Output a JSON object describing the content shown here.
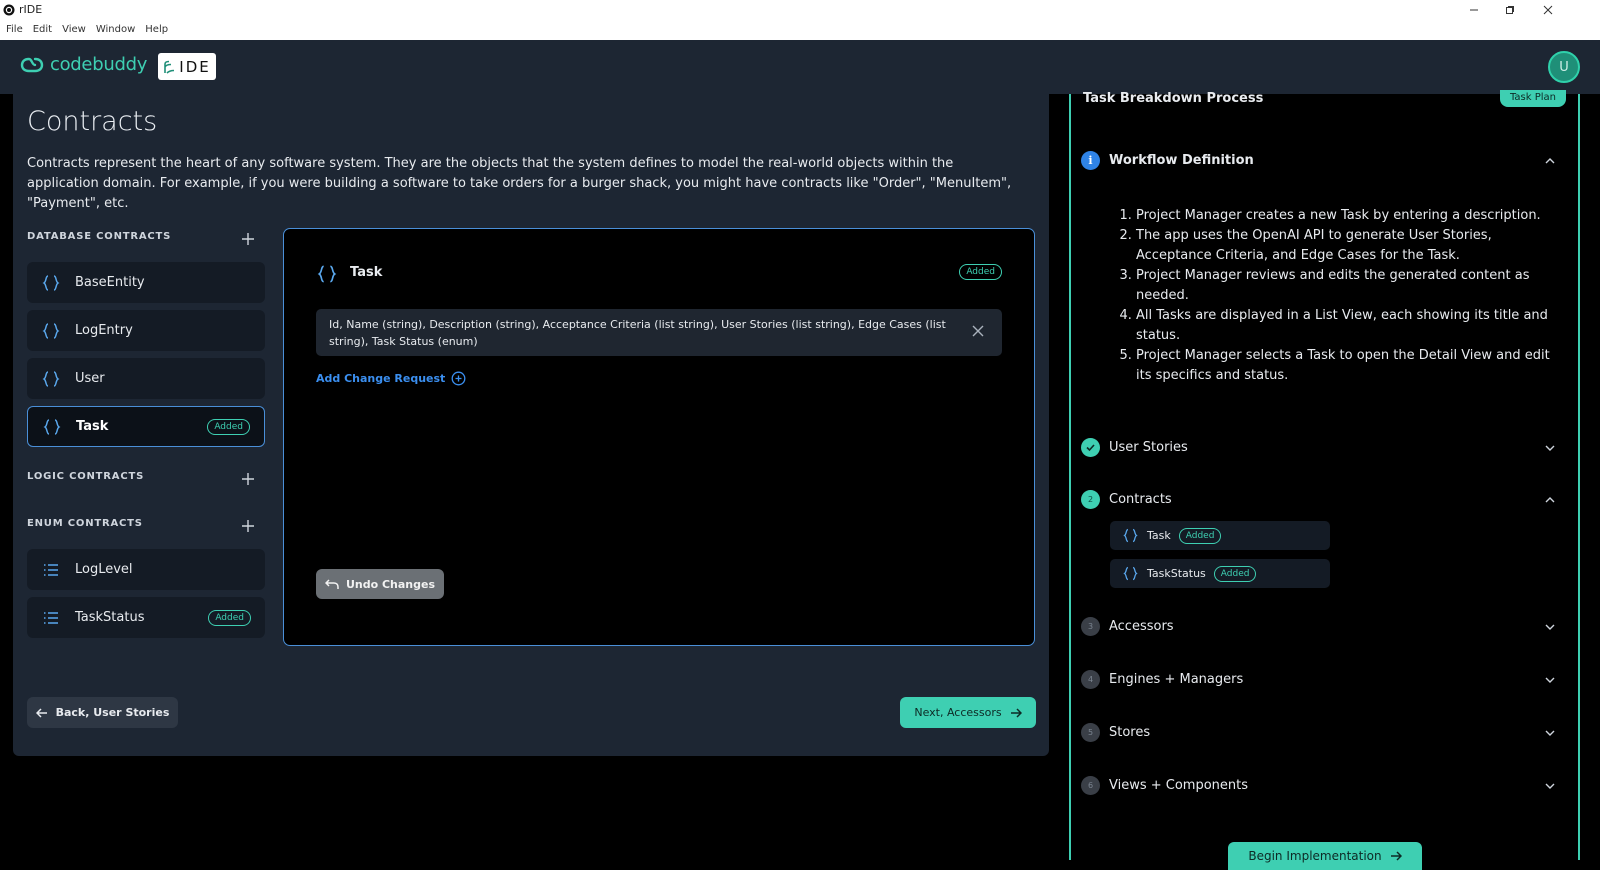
{
  "window": {
    "title": "rIDE"
  },
  "menu": [
    "File",
    "Edit",
    "View",
    "Window",
    "Help"
  ],
  "header": {
    "brand": "codebuddy",
    "product": "IDE",
    "avatar_initial": "U"
  },
  "main": {
    "title": "Contracts",
    "intro": "Contracts represent the heart of any software system. They are the objects that the system defines to model the real-world objects within the application domain. For example, if you were building a software to take orders for a burger shack, you might have contracts like \"Order\", \"MenuItem\", \"Payment\", etc.",
    "database_label": "DATABASE CONTRACTS",
    "logic_label": "LOGIC CONTRACTS",
    "enum_label": "ENUM CONTRACTS",
    "database_contracts": [
      {
        "name": "BaseEntity",
        "badge": ""
      },
      {
        "name": "LogEntry",
        "badge": ""
      },
      {
        "name": "User",
        "badge": ""
      },
      {
        "name": "Task",
        "badge": "Added"
      }
    ],
    "enum_contracts": [
      {
        "name": "LogLevel",
        "badge": ""
      },
      {
        "name": "TaskStatus",
        "badge": "Added"
      }
    ],
    "editor": {
      "title": "Task",
      "badge": "Added",
      "change_text": "Id, Name (string), Description (string), Acceptance Criteria (list string), User Stories (list string), Edge Cases (list string), Task Status (enum)",
      "add_change_label": "Add Change Request",
      "undo_label": "Undo Changes"
    },
    "back_label": "Back, User Stories",
    "next_label": "Next, Accessors"
  },
  "side": {
    "heading": "Task Breakdown Process",
    "task_plan_label": "Task Plan",
    "workflow_title": "Workflow Definition",
    "workflow_steps": [
      "Project Manager creates a new Task by entering a description.",
      "The app uses the OpenAI API to generate User Stories, Acceptance Criteria, and Edge Cases for the Task.",
      "Project Manager reviews and edits the generated content as needed.",
      "All Tasks are displayed in a List View, each showing its title and status.",
      "Project Manager selects a Task to open the Detail View and edit its specifics and status."
    ],
    "steps": [
      {
        "num": "",
        "label": "User Stories"
      },
      {
        "num": "2",
        "label": "Contracts"
      },
      {
        "num": "3",
        "label": "Accessors"
      },
      {
        "num": "4",
        "label": "Engines + Managers"
      },
      {
        "num": "5",
        "label": "Stores"
      },
      {
        "num": "6",
        "label": "Views + Components"
      }
    ],
    "contract_list": [
      {
        "name": "Task",
        "badge": "Added"
      },
      {
        "name": "TaskStatus",
        "badge": "Added"
      }
    ],
    "begin_label": "Begin Implementation"
  },
  "colors": {
    "accent": "#3ecfb2",
    "link": "#3b8ff0",
    "panel": "#1d2633"
  }
}
